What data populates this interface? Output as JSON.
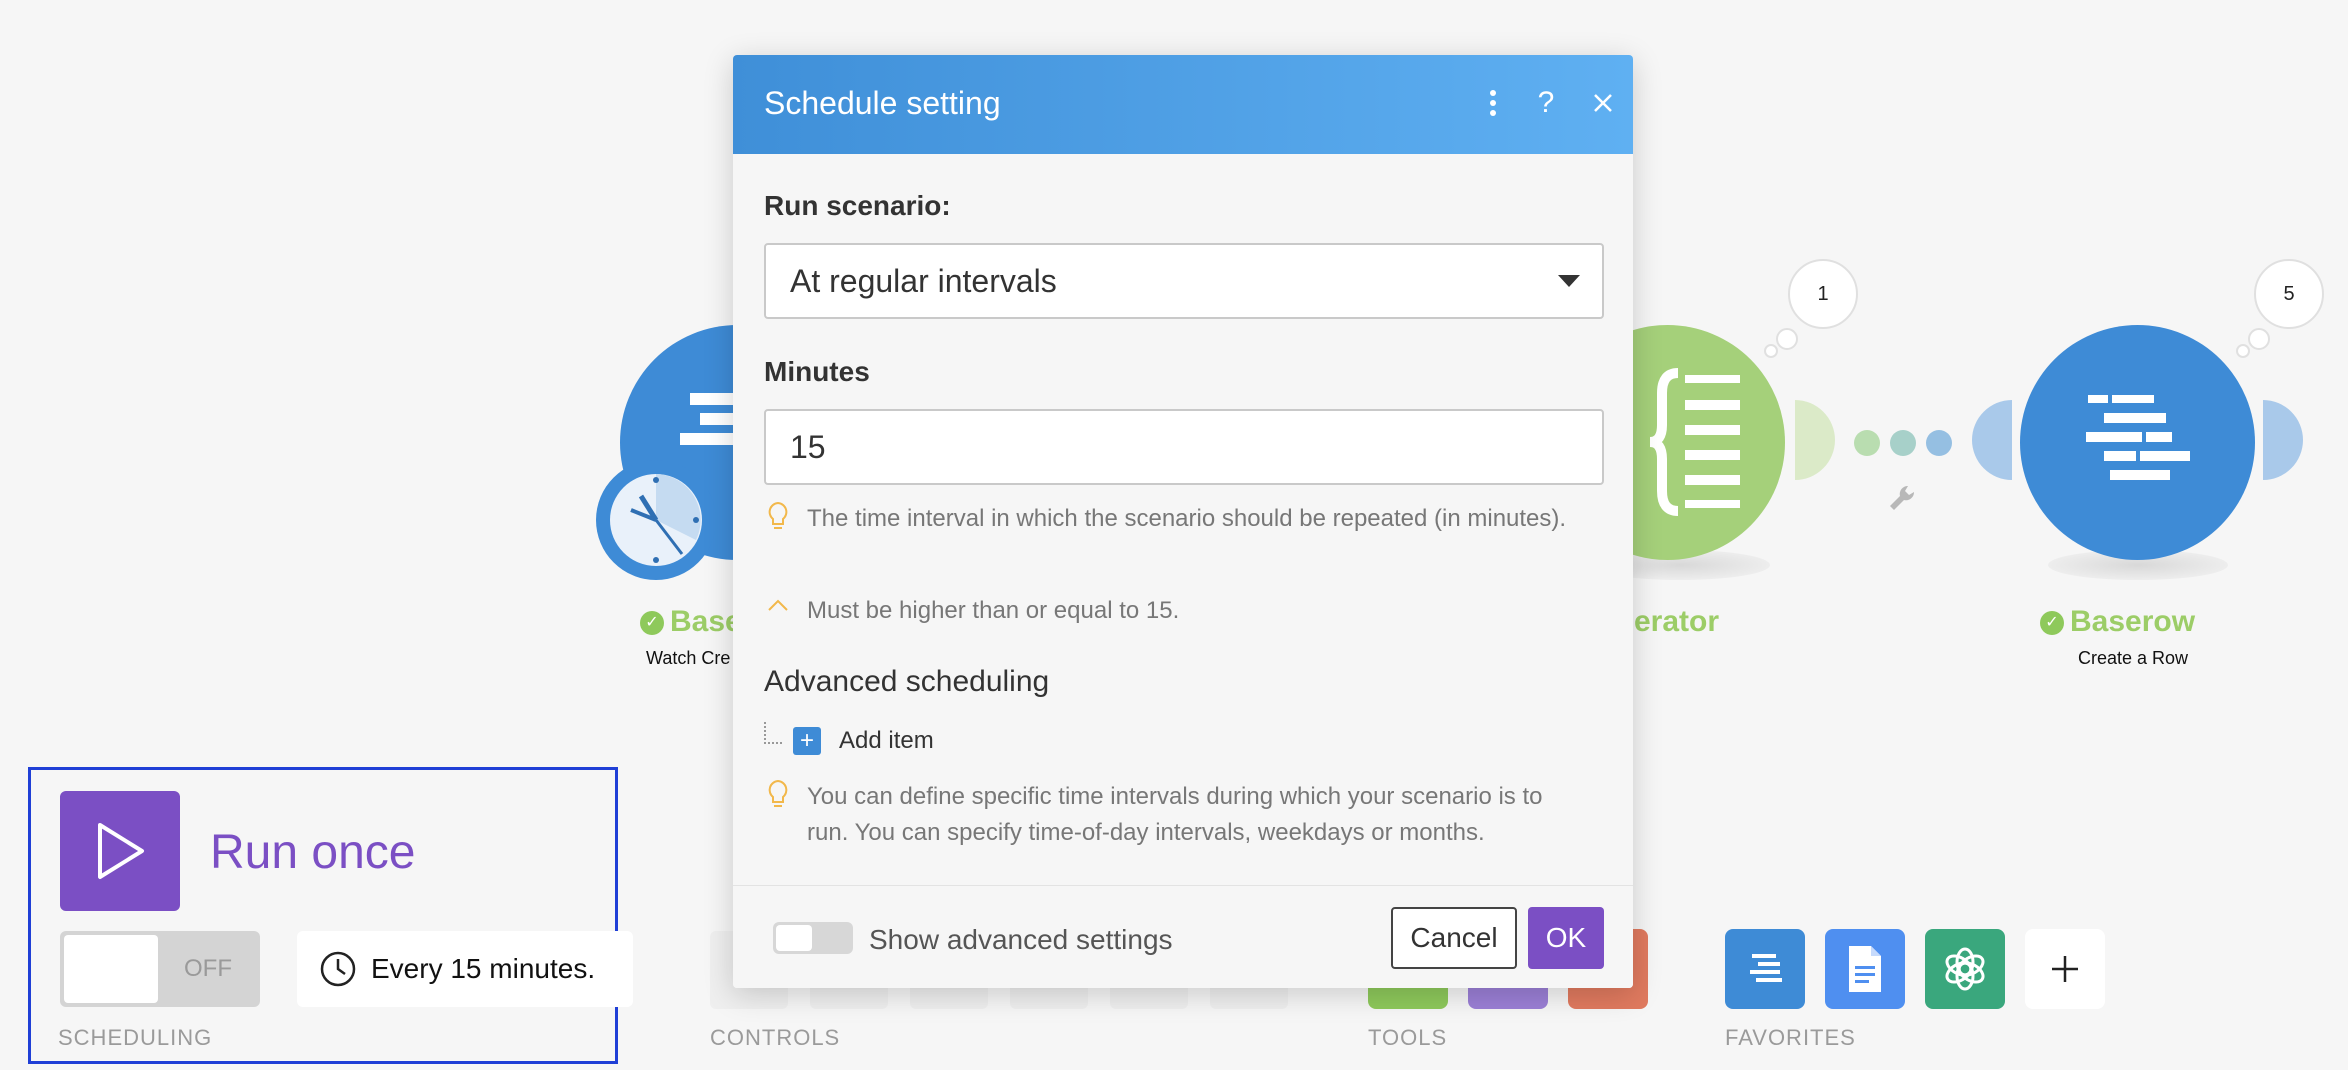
{
  "scenario": {
    "modules": [
      {
        "title": "Baserow",
        "subtitle": "Watch Created Rows",
        "visible_title": "Base",
        "visible_subtitle": "Watch Cre"
      },
      {
        "title": "Iterator",
        "visible_title": "erator"
      },
      {
        "title": "Baserow",
        "subtitle": "Create a Row",
        "bubble": "5"
      }
    ],
    "iterator_bubble": "1"
  },
  "toolbar": {
    "run_once_label": "Run once",
    "toggle_label": "OFF",
    "interval_text": "Every 15 minutes.",
    "sections": {
      "scheduling": "SCHEDULING",
      "controls": "CONTROLS",
      "tools": "TOOLS",
      "favorites": "FAVORITES"
    },
    "favorites": [
      "baserow-icon",
      "google-docs-icon",
      "openai-icon",
      "plus-icon"
    ]
  },
  "modal": {
    "title": "Schedule setting",
    "run_scenario_label": "Run scenario:",
    "run_scenario_value": "At regular intervals",
    "minutes_label": "Minutes",
    "minutes_value": "15",
    "hint_interval": "The time interval in which the scenario should be repeated (in minutes).",
    "hint_min": "Must be higher than or equal to 15.",
    "advanced_label": "Advanced scheduling",
    "add_item_label": "Add item",
    "hint_advanced": "You can define specific time intervals during which your scenario is to run. You can specify time-of-day intervals, weekdays or months.",
    "show_advanced_label": "Show advanced settings",
    "cancel_label": "Cancel",
    "ok_label": "OK"
  },
  "colors": {
    "accent": "#7b4fc4",
    "baserow_blue": "#3e8bd6",
    "iterator_green": "#a5d07a",
    "highlight_border": "#1f3fd6"
  }
}
